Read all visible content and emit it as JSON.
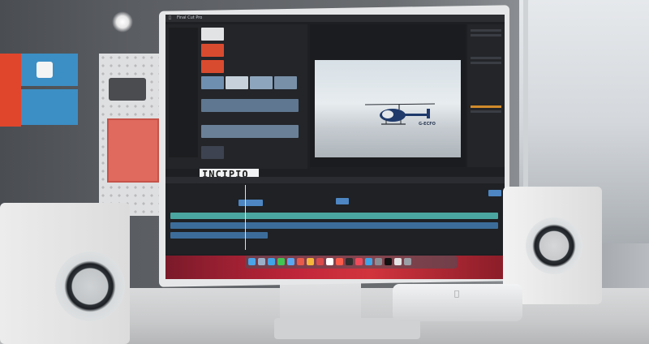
{
  "scene": {
    "description_tags": [
      "desk-setup",
      "monitor",
      "speakers",
      "mac-mini"
    ],
    "colors": {
      "accent_red": "#e0462c",
      "accent_blue": "#3c8fc5",
      "screen_bg": "#1d1f23",
      "timeline_blue": "#4d86c2",
      "timeline_teal": "#4aa6a0"
    }
  },
  "monitor": {
    "menubar_text": "Final Cut Pro",
    "viewer_title": "",
    "viewer_label": "G-ECFO",
    "browser_logo": "INCIPIO",
    "browser_groups": [
      "",
      "",
      ""
    ],
    "timeline_label": ""
  },
  "icons": {
    "apple": "apple-icon",
    "lamp": "lamp-icon"
  }
}
